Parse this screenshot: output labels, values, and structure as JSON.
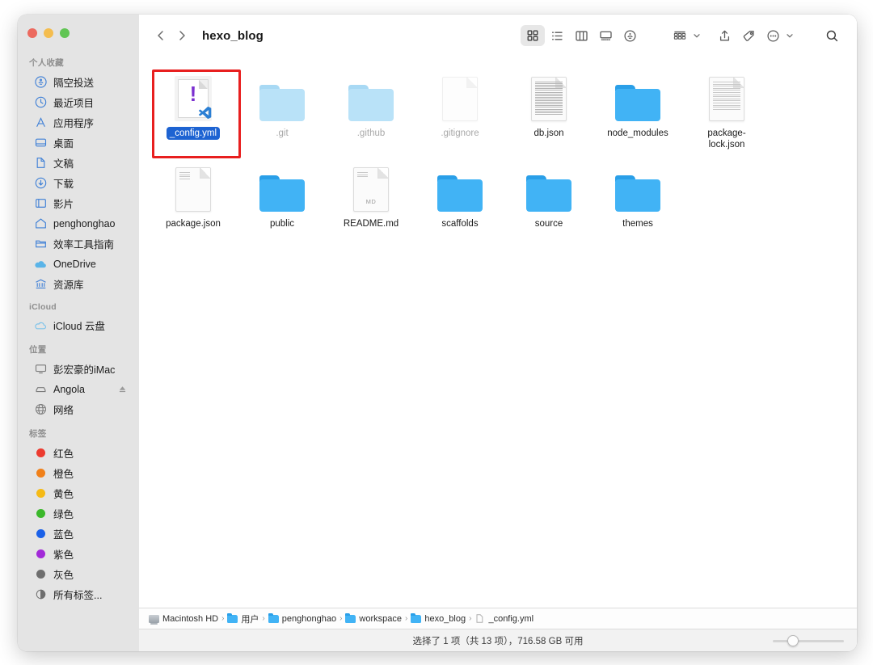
{
  "window": {
    "title": "hexo_blog",
    "traffic_lights": [
      "close",
      "minimize",
      "zoom"
    ]
  },
  "toolbar": {
    "back_label": "‹",
    "forward_label": "›",
    "view_icon_grid": "grid-view-icon",
    "view_icon_list": "list-view-icon",
    "view_icon_column": "column-view-icon",
    "view_icon_gallery": "gallery-view-icon",
    "airdrop_icon": "airdrop-icon",
    "group_icon": "group-by-icon",
    "share_icon": "share-icon",
    "tag_icon": "tag-icon",
    "more_icon": "more-actions-icon",
    "search_icon": "search-icon"
  },
  "sidebar": {
    "groups": [
      {
        "title": "个人收藏",
        "items": [
          {
            "label": "隔空投送",
            "icon": "airdrop-icon"
          },
          {
            "label": "最近项目",
            "icon": "clock-icon"
          },
          {
            "label": "应用程序",
            "icon": "applications-icon"
          },
          {
            "label": "桌面",
            "icon": "desktop-icon"
          },
          {
            "label": "文稿",
            "icon": "documents-icon"
          },
          {
            "label": "下载",
            "icon": "downloads-icon"
          },
          {
            "label": "影片",
            "icon": "movies-icon"
          },
          {
            "label": "penghonghao",
            "icon": "home-icon"
          },
          {
            "label": "效率工具指南",
            "icon": "folder-icon"
          },
          {
            "label": "OneDrive",
            "icon": "cloud-icon"
          },
          {
            "label": "资源库",
            "icon": "library-icon"
          }
        ]
      },
      {
        "title": "iCloud",
        "items": [
          {
            "label": "iCloud 云盘",
            "icon": "icloud-icon"
          }
        ]
      },
      {
        "title": "位置",
        "items": [
          {
            "label": "彭宏豪的iMac",
            "icon": "imac-icon"
          },
          {
            "label": "Angola",
            "icon": "external-drive-icon",
            "eject": "eject-icon"
          },
          {
            "label": "网络",
            "icon": "network-icon"
          }
        ]
      },
      {
        "title": "标签",
        "items": [
          {
            "label": "红色",
            "icon": "tag-dot",
            "color": "#ec3b2f"
          },
          {
            "label": "橙色",
            "icon": "tag-dot",
            "color": "#f08019"
          },
          {
            "label": "黄色",
            "icon": "tag-dot",
            "color": "#f5ba16"
          },
          {
            "label": "绿色",
            "icon": "tag-dot",
            "color": "#3bb82b"
          },
          {
            "label": "蓝色",
            "icon": "tag-dot",
            "color": "#1b61e8"
          },
          {
            "label": "紫色",
            "icon": "tag-dot",
            "color": "#a22ad8"
          },
          {
            "label": "灰色",
            "icon": "tag-dot",
            "color": "#6e6e6e"
          },
          {
            "label": "所有标签...",
            "icon": "all-tags-icon"
          }
        ]
      }
    ]
  },
  "files": [
    {
      "name": "_config.yml",
      "type": "yaml",
      "selected": true,
      "dim": false,
      "annotated": true
    },
    {
      "name": ".git",
      "type": "folder",
      "selected": false,
      "dim": true
    },
    {
      "name": ".github",
      "type": "folder",
      "selected": false,
      "dim": true
    },
    {
      "name": ".gitignore",
      "type": "doc-blank",
      "selected": false,
      "dim": true
    },
    {
      "name": "db.json",
      "type": "doc-dense",
      "selected": false,
      "dim": false
    },
    {
      "name": "node_modules",
      "type": "folder",
      "selected": false,
      "dim": false
    },
    {
      "name": "package-lock.json",
      "type": "doc-lines",
      "selected": false,
      "dim": false
    },
    {
      "name": "package.json",
      "type": "doc-corner",
      "selected": false,
      "dim": false
    },
    {
      "name": "public",
      "type": "folder",
      "selected": false,
      "dim": false
    },
    {
      "name": "README.md",
      "type": "doc-md",
      "selected": false,
      "dim": false
    },
    {
      "name": "scaffolds",
      "type": "folder",
      "selected": false,
      "dim": false
    },
    {
      "name": "source",
      "type": "folder",
      "selected": false,
      "dim": false
    },
    {
      "name": "themes",
      "type": "folder",
      "selected": false,
      "dim": false
    }
  ],
  "pathbar": [
    {
      "label": "Macintosh HD",
      "icon": "hard-drive-icon"
    },
    {
      "label": "用户",
      "icon": "users-folder-icon"
    },
    {
      "label": "penghonghao",
      "icon": "home-folder-icon"
    },
    {
      "label": "workspace",
      "icon": "folder-icon"
    },
    {
      "label": "hexo_blog",
      "icon": "folder-icon"
    },
    {
      "label": "_config.yml",
      "icon": "file-icon"
    }
  ],
  "statusbar": {
    "text": "选择了 1 项（共 13 项），716.58 GB 可用",
    "zoom_slider_value": 35
  },
  "colors": {
    "accent": "#1d63d2",
    "folder": "#41b3f5",
    "folder_dim": "#b9e2f8",
    "annotation": "#e81f1f",
    "sidebar_bg": "#e4e4e4"
  }
}
